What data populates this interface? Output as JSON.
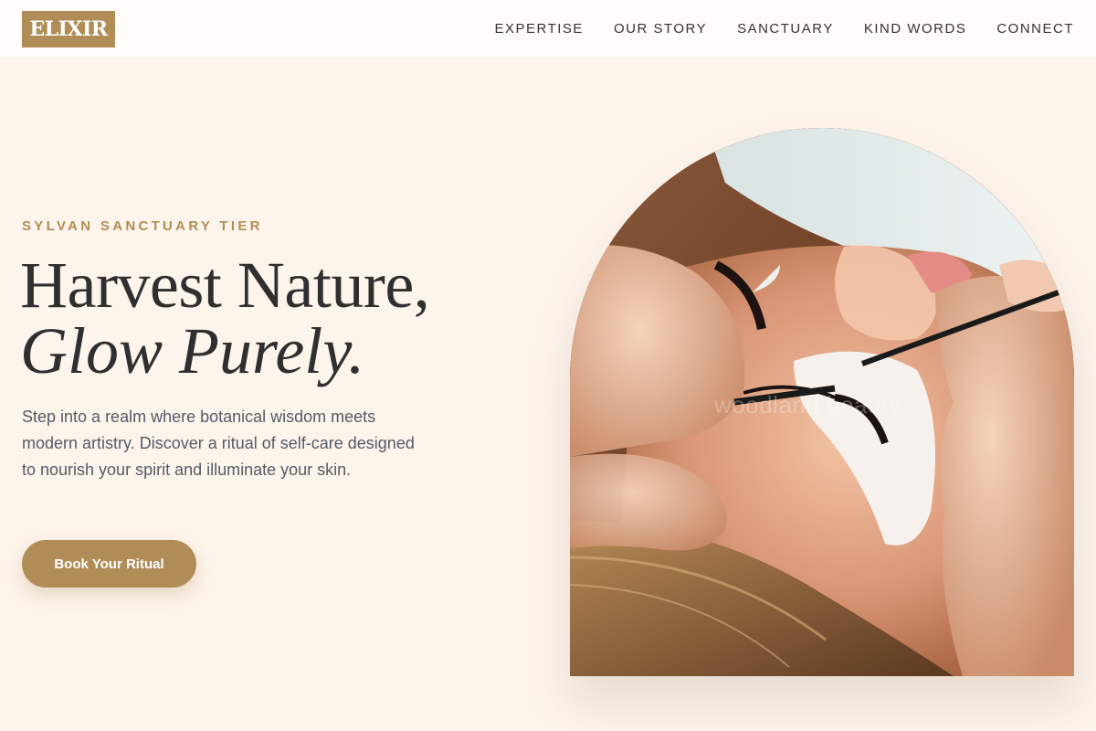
{
  "brand": {
    "logo_text": "ELIXIR"
  },
  "nav": {
    "items": [
      "EXPERTISE",
      "OUR STORY",
      "SANCTUARY",
      "KIND WORDS",
      "CONNECT"
    ]
  },
  "hero": {
    "eyebrow": "SYLVAN SANCTUARY TIER",
    "headline_line1": "Harvest Nature,",
    "headline_line2": "Glow Purely.",
    "description": "Step into a realm where botanical wisdom meets modern artistry. Discover a ritual of self-care designed to nourish your spirit and illuminate your skin.",
    "cta_label": "Book Your Ritual"
  },
  "image": {
    "watermark_text": "woodland beauty",
    "subject": "eyelash-extension-treatment-photo"
  },
  "colors": {
    "accent": "#b08d57",
    "background": "#fdf4ec",
    "header_bg": "#fffcfa",
    "text_dark": "#2f2f2f",
    "text_body": "#555b66"
  }
}
